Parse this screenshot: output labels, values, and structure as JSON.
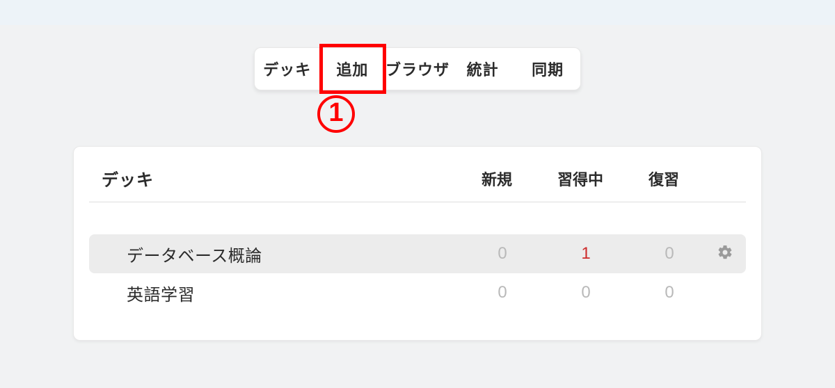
{
  "tabs": {
    "decks": "デッキ",
    "add": "追加",
    "browse": "ブラウザ",
    "stats": "統計",
    "sync": "同期"
  },
  "annotation": {
    "step": "1"
  },
  "table": {
    "headers": {
      "deck": "デッキ",
      "new": "新規",
      "learn": "習得中",
      "review": "復習"
    },
    "rows": [
      {
        "name": "データベース概論",
        "new": "0",
        "learn": "1",
        "review": "0",
        "selected": true,
        "gear": true
      },
      {
        "name": "英語学習",
        "new": "0",
        "learn": "0",
        "review": "0",
        "selected": false,
        "gear": false
      }
    ]
  }
}
